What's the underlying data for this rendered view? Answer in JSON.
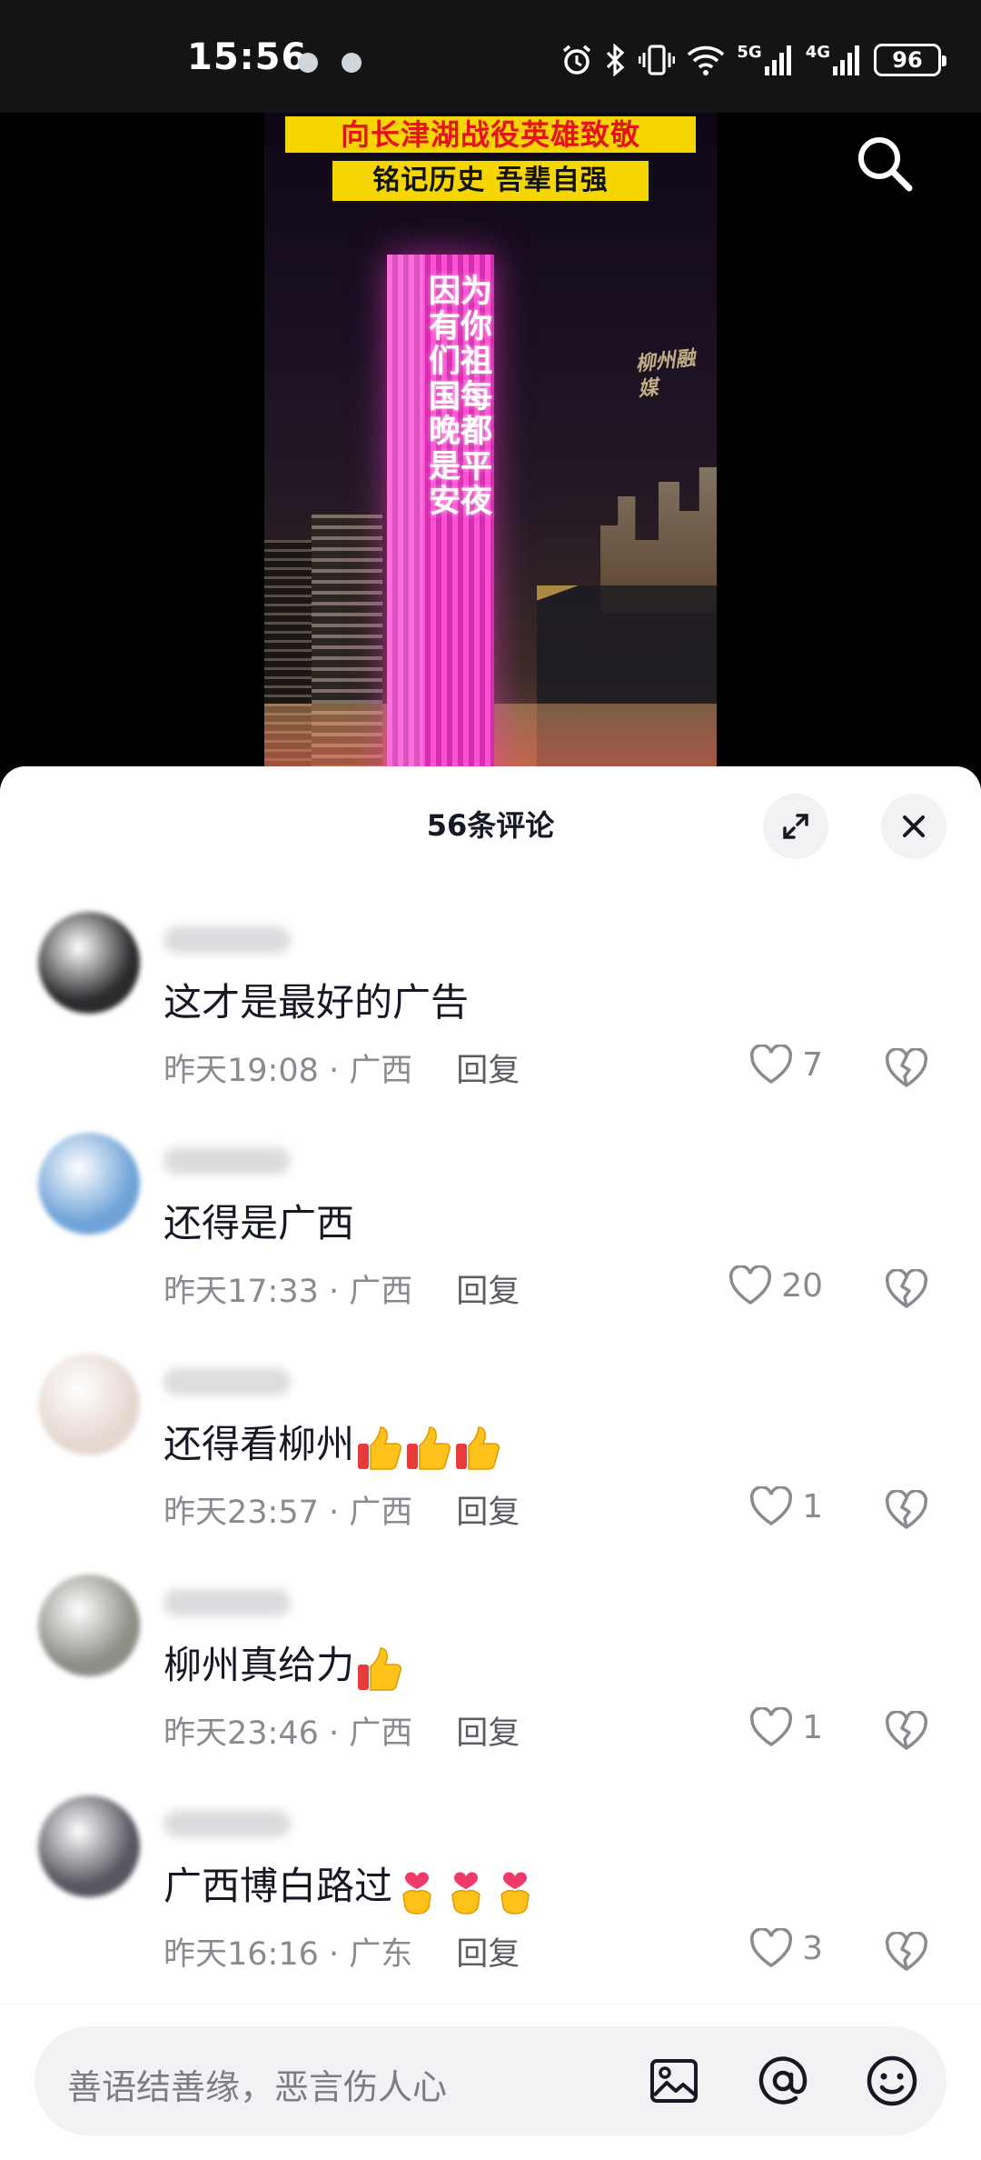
{
  "status_bar": {
    "time": "15:56",
    "network_5g": "5G",
    "network_4g": "4G",
    "battery": "96"
  },
  "video": {
    "caption_line1": "向长津湖战役英雄致敬",
    "caption_line2": "铭记历史 吾辈自强",
    "tower_text": "因为有你们祖国每晚都是平安夜",
    "watermark": "柳州融媒"
  },
  "comments_panel": {
    "title": "56条评论",
    "input_placeholder": "善语结善缘，恶言伤人心",
    "comments": [
      {
        "text": "这才是最好的广告",
        "emoji_count": 0,
        "time": "昨天19:08",
        "location": "广西",
        "reply": "回复",
        "likes": "7",
        "avatar_color": "#2b2b2e"
      },
      {
        "text": "还得是广西",
        "emoji_count": 0,
        "time": "昨天17:33",
        "location": "广西",
        "reply": "回复",
        "likes": "20",
        "avatar_color": "#6fa3d8"
      },
      {
        "text": "还得看柳州",
        "emoji_count": 3,
        "emoji": "thumbs-up",
        "time": "昨天23:57",
        "location": "广西",
        "reply": "回复",
        "likes": "1",
        "avatar_color": "#e6d8d0"
      },
      {
        "text": "柳州真给力",
        "emoji_count": 1,
        "emoji": "thumbs-up",
        "time": "昨天23:46",
        "location": "广西",
        "reply": "回复",
        "likes": "1",
        "avatar_color": "#8c8f86"
      },
      {
        "text": "广西博白路过",
        "emoji_count": 3,
        "emoji": "finger-heart",
        "time": "昨天16:16",
        "location": "广东",
        "reply": "回复",
        "likes": "3",
        "avatar_color": "#5a5660"
      }
    ]
  },
  "colors": {
    "text_primary": "#161823",
    "text_secondary": "#8a8b91",
    "tower_pink": "#ff4fd3",
    "caption_yellow": "#f6d600",
    "caption_red": "#e4131d"
  }
}
